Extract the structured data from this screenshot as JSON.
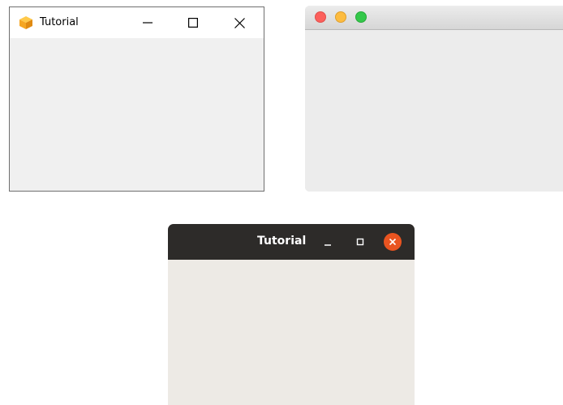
{
  "windows": {
    "windows_style": {
      "title": "Tutorial",
      "app_icon": "cube-icon",
      "controls": [
        "minimize-icon",
        "maximize-icon",
        "close-icon"
      ],
      "colors": {
        "titlebar": "#ffffff",
        "client": "#f0f0f0",
        "border": "#6f6f6f",
        "icon": "#f5a623"
      }
    },
    "macos_style": {
      "controls": [
        "close-icon",
        "minimize-icon",
        "zoom-icon"
      ],
      "colors": {
        "close": "#fc605c",
        "minimize": "#fdbc40",
        "zoom": "#34c84a",
        "client": "#ececec"
      }
    },
    "ubuntu_style": {
      "title": "Tutorial",
      "controls": [
        "minimize-icon",
        "maximize-icon",
        "close-icon"
      ],
      "colors": {
        "titlebar": "#2d2b29",
        "close": "#e95420",
        "client": "#edeae5"
      }
    }
  }
}
